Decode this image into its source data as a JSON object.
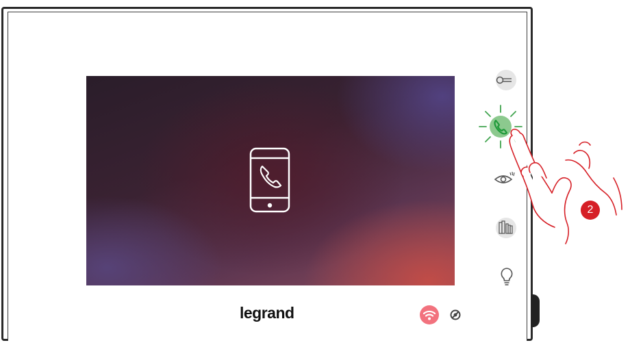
{
  "brand": {
    "logo_text": "legrand"
  },
  "screen": {
    "center_icon": "smartphone-call-icon"
  },
  "side_buttons": [
    {
      "name": "key-button",
      "icon": "key-icon"
    },
    {
      "name": "answer-call-button",
      "icon": "phone-handset-icon",
      "state": "lit-green"
    },
    {
      "name": "camera-cycle-button",
      "icon": "eye-icon"
    },
    {
      "name": "gate-button",
      "icon": "gate-icon"
    },
    {
      "name": "light-button",
      "icon": "lightbulb-icon"
    }
  ],
  "status": {
    "wifi_icon": "wifi-icon",
    "wifi_color": "#f2727e",
    "mute_icon": "mute-icon"
  },
  "step_badge": {
    "number": "2",
    "color": "#d61f26"
  },
  "colors": {
    "green_lit": "#8cc98e",
    "green_icon": "#1f9a3a",
    "icon_grey": "#555555"
  }
}
